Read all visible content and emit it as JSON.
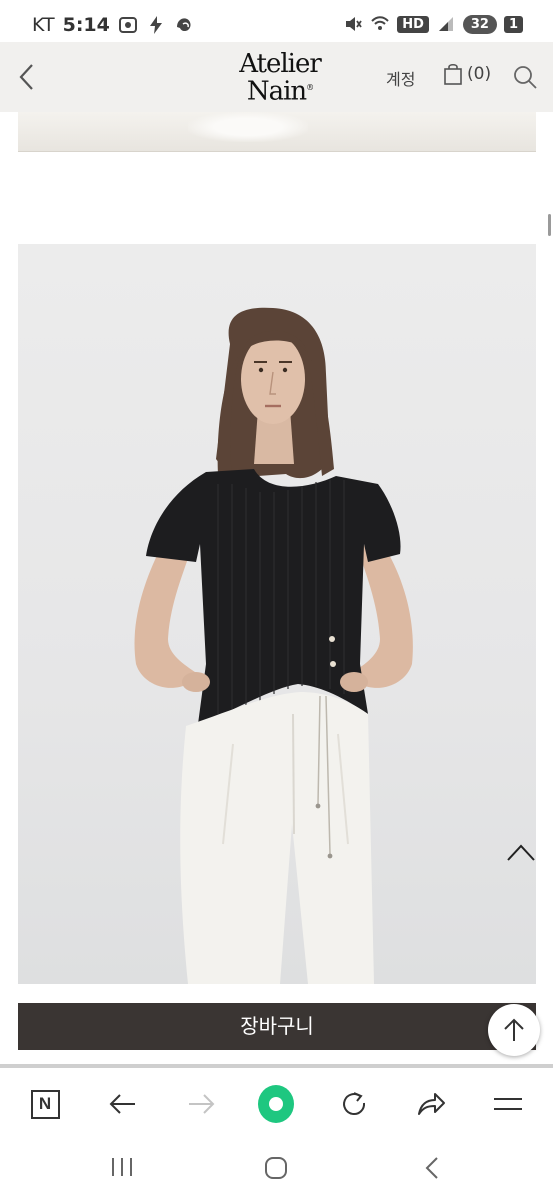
{
  "status_bar": {
    "carrier": "KT",
    "time": "5:14",
    "hd_label": "HD",
    "notification_count": "32",
    "sim_badge": "1"
  },
  "header": {
    "logo_line1": "Atelier",
    "logo_line2": "Nain",
    "logo_mark": "®",
    "account_label": "계정",
    "cart_count": "(0)"
  },
  "product": {
    "cart_button_label": "장바구니"
  },
  "browser_toolbar": {
    "n_label": "N"
  },
  "icons": {
    "back": "chevron-left-icon",
    "cart": "shopping-bag-icon",
    "search": "search-icon",
    "scroll_up": "chevron-up-icon",
    "to_top": "arrow-up-icon",
    "refresh": "refresh-icon",
    "share": "share-icon",
    "menu": "menu-icon"
  },
  "colors": {
    "header_bg": "#f1f0ee",
    "cart_bar_bg": "#3a3533",
    "green_dot": "#1ec780"
  }
}
